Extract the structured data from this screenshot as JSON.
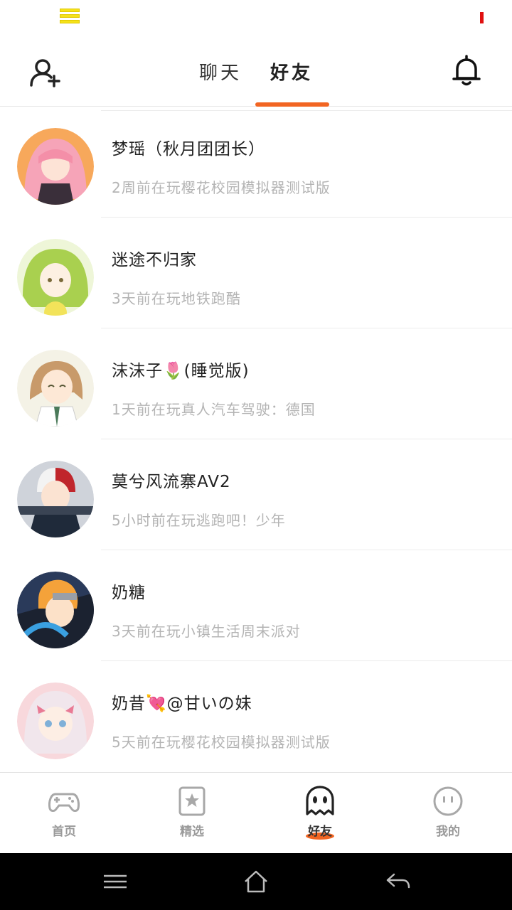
{
  "status_bar": {},
  "header": {
    "tabs": [
      {
        "label": "聊天",
        "active": false
      },
      {
        "label": "好友",
        "active": true
      }
    ],
    "accent_color": "#f26522"
  },
  "friends": [
    {
      "name": "梦瑶（秋月团团长）",
      "status": "2周前在玩樱花校园模拟器测试版"
    },
    {
      "name": "迷途不归家",
      "status": "3天前在玩地铁跑酷"
    },
    {
      "name": "沫沫子🌷(睡觉版)",
      "status": "1天前在玩真人汽车驾驶：德国"
    },
    {
      "name": "莫兮风流寨AV2",
      "status": "5小时前在玩逃跑吧！少年"
    },
    {
      "name": "奶糖",
      "status": "3天前在玩小镇生活周末派对"
    },
    {
      "name": "奶昔💘@甘いの妹",
      "status": "5天前在玩樱花校园模拟器测试版"
    }
  ],
  "bottom_nav": {
    "items": [
      {
        "label": "首页",
        "icon": "gamepad-icon",
        "active": false
      },
      {
        "label": "精选",
        "icon": "star-card-icon",
        "active": false
      },
      {
        "label": "好友",
        "icon": "ghost-icon",
        "active": true
      },
      {
        "label": "我的",
        "icon": "smiley-icon",
        "active": false
      }
    ]
  }
}
